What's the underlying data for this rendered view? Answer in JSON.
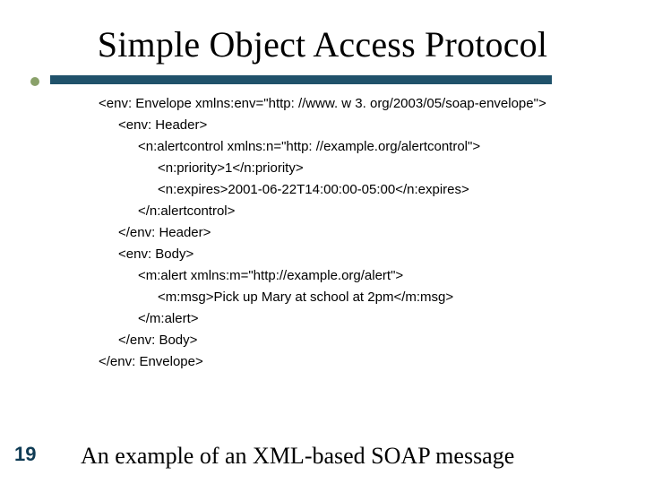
{
  "title": "Simple Object Access Protocol",
  "page_number": "19",
  "caption": "An example of an XML-based SOAP message",
  "code": {
    "l0": "<env: Envelope xmlns:env=\"http: //www. w 3. org/2003/05/soap-envelope\">",
    "l1": "<env: Header>",
    "l2": "<n:alertcontrol xmlns:n=\"http: //example.org/alertcontrol\">",
    "l3": "<n:priority>1</n:priority>",
    "l4": "<n:expires>2001-06-22T14:00:00-05:00</n:expires>",
    "l5": "</n:alertcontrol>",
    "l6": "</env: Header>",
    "l7": "<env: Body>",
    "l8": "<m:alert xmlns:m=\"http://example.org/alert\">",
    "l9": "<m:msg>Pick up Mary at school at 2pm</m:msg>",
    "l10": "</m:alert>",
    "l11": "</env: Body>",
    "l12": "</env: Envelope>"
  }
}
